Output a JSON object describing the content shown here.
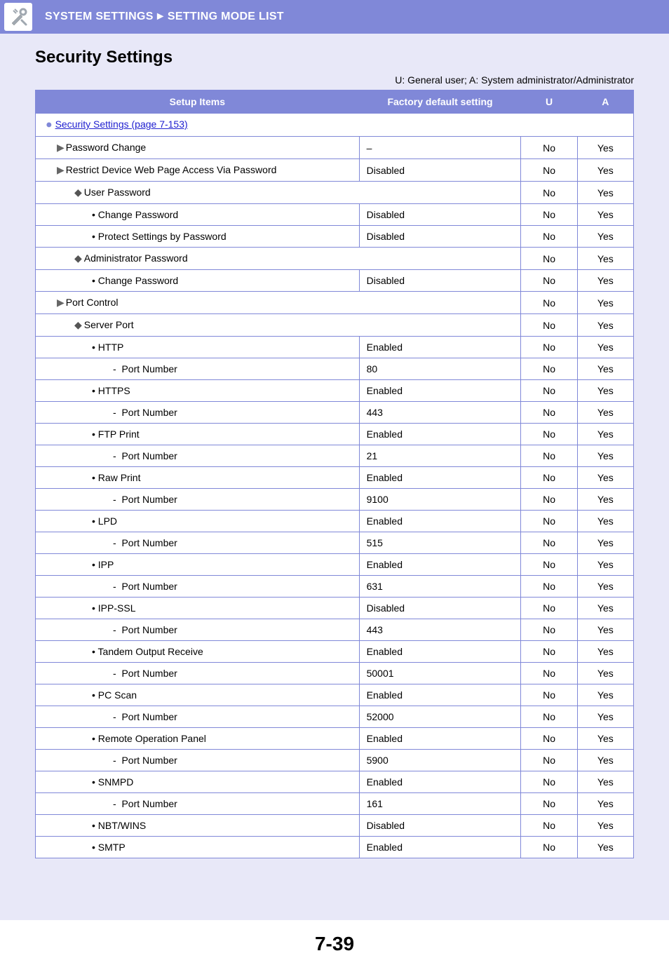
{
  "header": {
    "breadcrumb_a": "SYSTEM SETTINGS",
    "breadcrumb_b": "SETTING MODE LIST"
  },
  "section_title": "Security Settings",
  "legend": "U: General user; A: System administrator/Administrator",
  "columns": {
    "items": "Setup Items",
    "factory": "Factory default setting",
    "u": "U",
    "a": "A"
  },
  "section_link": "Security Settings (page 7-153)",
  "rows": [
    {
      "label": "Password Change",
      "indent": 1,
      "marker": "tri",
      "factory": "–",
      "u": "No",
      "a": "Yes"
    },
    {
      "label": "Restrict Device Web Page Access Via Password",
      "indent": 1,
      "marker": "tri",
      "factory": "Disabled",
      "u": "No",
      "a": "Yes"
    },
    {
      "label": "User Password",
      "indent": 2,
      "marker": "diamond",
      "span": true,
      "u": "No",
      "a": "Yes"
    },
    {
      "label": "Change Password",
      "indent": 3,
      "marker": "dot",
      "factory": "Disabled",
      "u": "No",
      "a": "Yes"
    },
    {
      "label": "Protect Settings by Password",
      "indent": 3,
      "marker": "dot",
      "factory": "Disabled",
      "u": "No",
      "a": "Yes"
    },
    {
      "label": "Administrator Password",
      "indent": 2,
      "marker": "diamond",
      "span": true,
      "u": "No",
      "a": "Yes"
    },
    {
      "label": "Change Password",
      "indent": 3,
      "marker": "dot",
      "factory": "Disabled",
      "u": "No",
      "a": "Yes"
    },
    {
      "label": "Port Control",
      "indent": 1,
      "marker": "tri",
      "span": true,
      "u": "No",
      "a": "Yes"
    },
    {
      "label": "Server Port",
      "indent": 2,
      "marker": "diamond",
      "span": true,
      "u": "No",
      "a": "Yes"
    },
    {
      "label": "HTTP",
      "indent": 3,
      "marker": "dot",
      "factory": "Enabled",
      "u": "No",
      "a": "Yes"
    },
    {
      "label": "Port Number",
      "indent": 4,
      "marker": "dash",
      "factory": "80",
      "u": "No",
      "a": "Yes"
    },
    {
      "label": "HTTPS",
      "indent": 3,
      "marker": "dot",
      "factory": "Enabled",
      "u": "No",
      "a": "Yes"
    },
    {
      "label": "Port Number",
      "indent": 4,
      "marker": "dash",
      "factory": "443",
      "u": "No",
      "a": "Yes"
    },
    {
      "label": "FTP Print",
      "indent": 3,
      "marker": "dot",
      "factory": "Enabled",
      "u": "No",
      "a": "Yes"
    },
    {
      "label": "Port Number",
      "indent": 4,
      "marker": "dash",
      "factory": "21",
      "u": "No",
      "a": "Yes"
    },
    {
      "label": "Raw Print",
      "indent": 3,
      "marker": "dot",
      "factory": "Enabled",
      "u": "No",
      "a": "Yes"
    },
    {
      "label": "Port Number",
      "indent": 4,
      "marker": "dash",
      "factory": "9100",
      "u": "No",
      "a": "Yes"
    },
    {
      "label": "LPD",
      "indent": 3,
      "marker": "dot",
      "factory": "Enabled",
      "u": "No",
      "a": "Yes"
    },
    {
      "label": "Port Number",
      "indent": 4,
      "marker": "dash",
      "factory": "515",
      "u": "No",
      "a": "Yes"
    },
    {
      "label": "IPP",
      "indent": 3,
      "marker": "dot",
      "factory": "Enabled",
      "u": "No",
      "a": "Yes"
    },
    {
      "label": "Port Number",
      "indent": 4,
      "marker": "dash",
      "factory": "631",
      "u": "No",
      "a": "Yes"
    },
    {
      "label": "IPP-SSL",
      "indent": 3,
      "marker": "dot",
      "factory": "Disabled",
      "u": "No",
      "a": "Yes"
    },
    {
      "label": "Port Number",
      "indent": 4,
      "marker": "dash",
      "factory": "443",
      "u": "No",
      "a": "Yes"
    },
    {
      "label": "Tandem Output Receive",
      "indent": 3,
      "marker": "dot",
      "factory": "Enabled",
      "u": "No",
      "a": "Yes"
    },
    {
      "label": "Port Number",
      "indent": 4,
      "marker": "dash",
      "factory": "50001",
      "u": "No",
      "a": "Yes"
    },
    {
      "label": "PC Scan",
      "indent": 3,
      "marker": "dot",
      "factory": "Enabled",
      "u": "No",
      "a": "Yes"
    },
    {
      "label": "Port Number",
      "indent": 4,
      "marker": "dash",
      "factory": "52000",
      "u": "No",
      "a": "Yes"
    },
    {
      "label": "Remote Operation Panel",
      "indent": 3,
      "marker": "dot",
      "factory": "Enabled",
      "u": "No",
      "a": "Yes"
    },
    {
      "label": "Port Number",
      "indent": 4,
      "marker": "dash",
      "factory": "5900",
      "u": "No",
      "a": "Yes"
    },
    {
      "label": "SNMPD",
      "indent": 3,
      "marker": "dot",
      "factory": "Enabled",
      "u": "No",
      "a": "Yes"
    },
    {
      "label": "Port Number",
      "indent": 4,
      "marker": "dash",
      "factory": "161",
      "u": "No",
      "a": "Yes"
    },
    {
      "label": "NBT/WINS",
      "indent": 3,
      "marker": "dot",
      "factory": "Disabled",
      "u": "No",
      "a": "Yes"
    },
    {
      "label": "SMTP",
      "indent": 3,
      "marker": "dot",
      "factory": "Enabled",
      "u": "No",
      "a": "Yes"
    }
  ],
  "page_number": "7-39"
}
